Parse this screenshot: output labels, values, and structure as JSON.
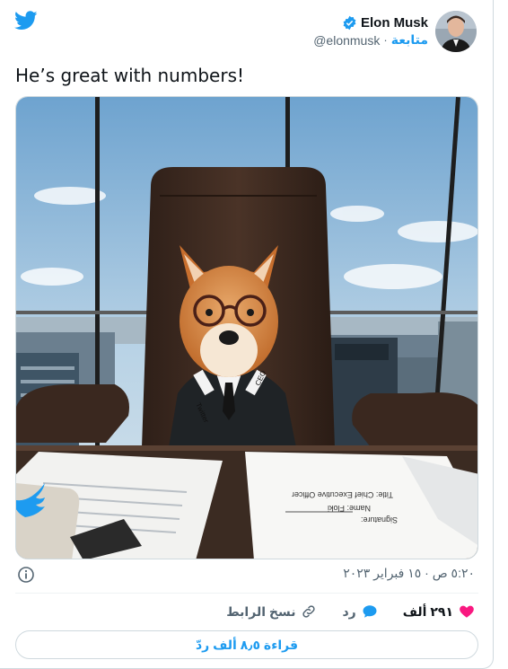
{
  "author": {
    "name": "Elon Musk",
    "handle": "@elonmusk",
    "follow_label": "متابعة",
    "separator": "·"
  },
  "tweet": {
    "text": "He’s great with numbers!"
  },
  "photo": {
    "badge_left": "Twitter",
    "badge_right": "CEO",
    "paper_line_1": "Title: Chief Executive Officer",
    "paper_line_2": "Name: Floki",
    "paper_line_3": "Signature:"
  },
  "meta": {
    "timestamp": "٥:٢٠ ص · ١٥ فبراير ٢٠٢٣"
  },
  "actions": {
    "likes": "٢٩١ ألف",
    "reply_label": "رد",
    "copy_link_label": "نسخ الرابط"
  },
  "replies_button": "قراءة ٨٫٥ ألف ردّ",
  "colors": {
    "accent": "#1d9bf0",
    "like": "#f91880",
    "text": "#0f1419",
    "muted": "#536471",
    "border": "#cfd9de"
  },
  "icons": [
    "twitter-bird-icon",
    "verified-badge-icon",
    "info-icon",
    "heart-icon",
    "reply-icon",
    "link-icon"
  ]
}
